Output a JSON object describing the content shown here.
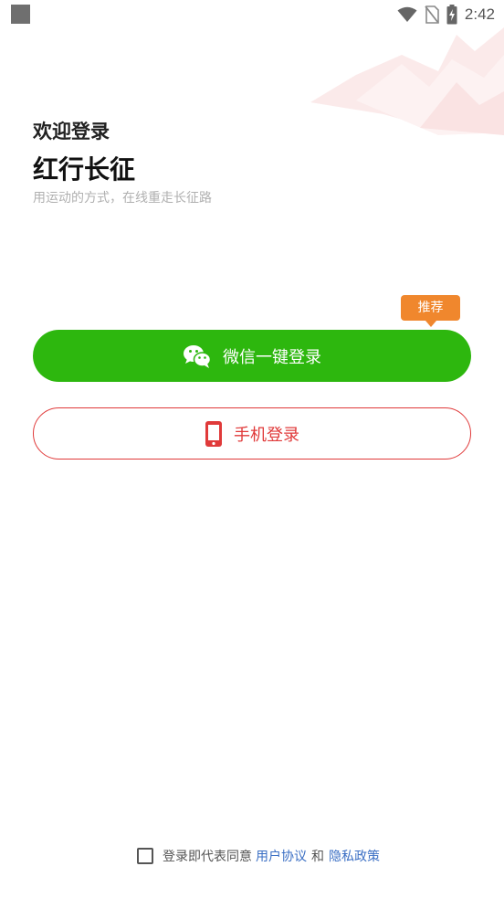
{
  "status_bar": {
    "time": "2:42",
    "icons": [
      "wifi-icon",
      "no-sim-icon",
      "battery-charging-icon"
    ]
  },
  "welcome": {
    "greeting": "欢迎登录",
    "app_name": "红行长征",
    "slogan": "用运动的方式，在线重走长征路"
  },
  "login": {
    "recommend_tag": "推荐",
    "wechat_label": "微信一键登录",
    "wechat_icon": "wechat-icon",
    "phone_label": "手机登录",
    "phone_icon": "phone-icon"
  },
  "agreement": {
    "checked": false,
    "prefix": "登录即代表同意",
    "user_agreement": "用户协议",
    "and": "和",
    "privacy_policy": "隐私政策"
  },
  "colors": {
    "wechat_green": "#2db70e",
    "phone_red": "#e03a3a",
    "tag_orange": "#f0872d",
    "link_blue": "#3b6fc4"
  }
}
